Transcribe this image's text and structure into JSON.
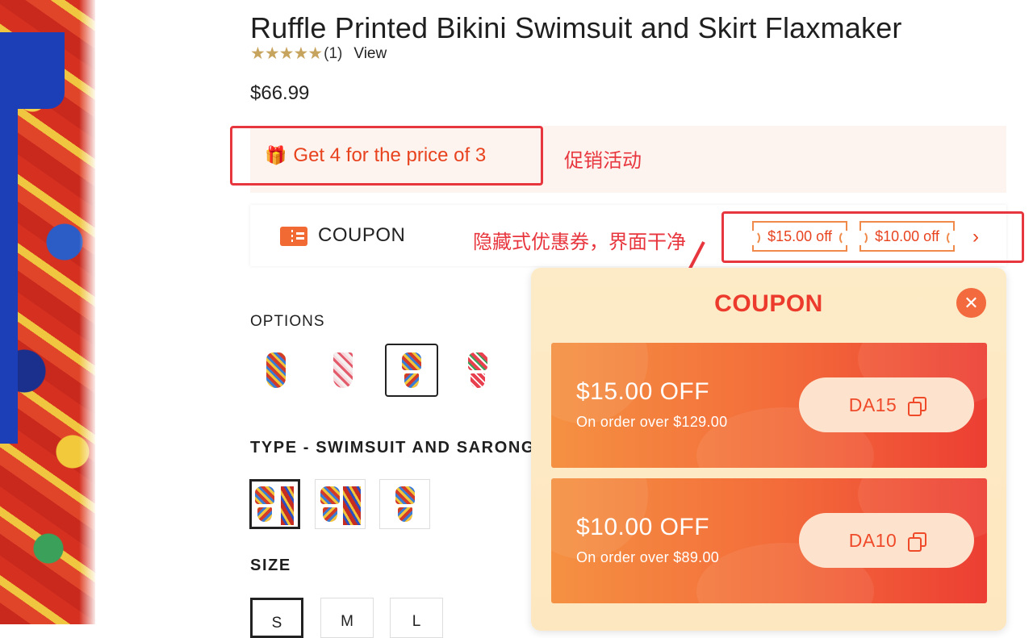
{
  "product": {
    "title": "Ruffle Printed Bikini Swimsuit and Skirt Flaxmaker",
    "stars": "★★★★★",
    "review_count": "(1)",
    "view_label": "View",
    "price": "$66.99"
  },
  "promo": {
    "label": "Get 4 for the price of 3",
    "annotation": "促销活动"
  },
  "coupon_bar": {
    "label": "COUPON",
    "annotation": "隐藏式优惠券，界面干净",
    "chips": [
      "$15.00 off",
      "$10.00 off"
    ],
    "more_icon": "chevron-right-icon"
  },
  "options": {
    "label": "OPTIONS"
  },
  "type": {
    "label": "TYPE - SWIMSUIT AND SARONG"
  },
  "size": {
    "label": "SIZE",
    "values": [
      "S",
      "M",
      "L"
    ],
    "selected": "S"
  },
  "popup": {
    "title": "COUPON",
    "close_icon": "close-icon",
    "coupons": [
      {
        "amount": "$15.00 OFF",
        "condition": "On order over $129.00",
        "code": "DA15"
      },
      {
        "amount": "$10.00 OFF",
        "condition": "On order over $89.00",
        "code": "DA10"
      }
    ]
  },
  "colors": {
    "accent": "#e8431f",
    "annotation_red": "#e8363e",
    "card_start": "#f59142",
    "card_end": "#ec3e33",
    "popup_bg": "#fdebc7",
    "star": "#c7a45e"
  }
}
